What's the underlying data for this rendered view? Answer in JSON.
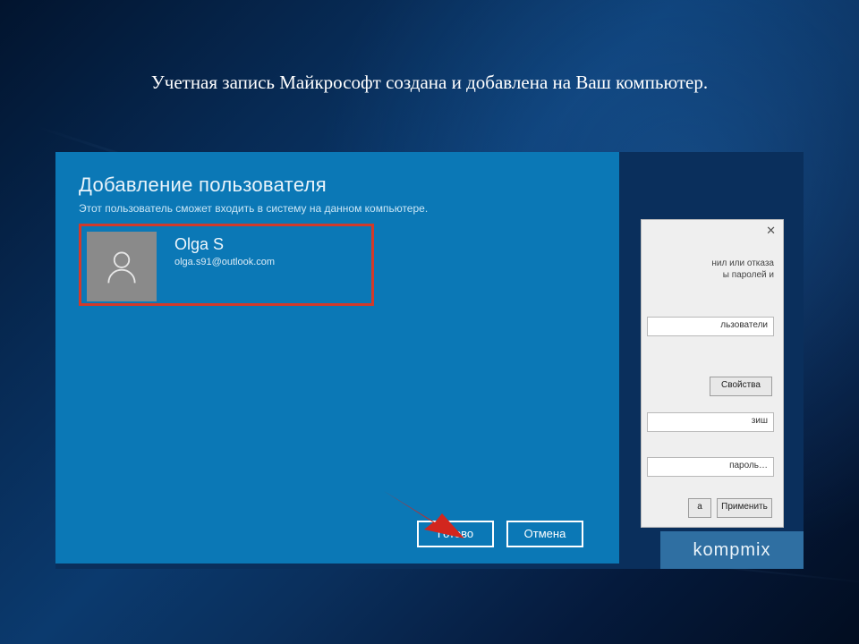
{
  "slide": {
    "caption": "Учетная запись Майкрософт создана и добавлена на Ваш компьютер."
  },
  "modal": {
    "title": "Добавление пользователя",
    "subtitle": "Этот пользователь сможет входить в систему на данном компьютере.",
    "user": {
      "name": "Olga S",
      "email": "olga.s91@outlook.com"
    },
    "buttons": {
      "ready": "Готово",
      "cancel": "Отмена"
    }
  },
  "behind": {
    "close": "✕",
    "text1": "нил или отказа",
    "text2": "ы паролей и",
    "field_users": "льзователи",
    "btn_props": "Свойства",
    "field_hint": "зиш",
    "field_pass": "пароль…",
    "btn_a": "а",
    "btn_apply": "Применить"
  },
  "watermark": "kompmix",
  "icons": {
    "avatar": "person-icon"
  }
}
